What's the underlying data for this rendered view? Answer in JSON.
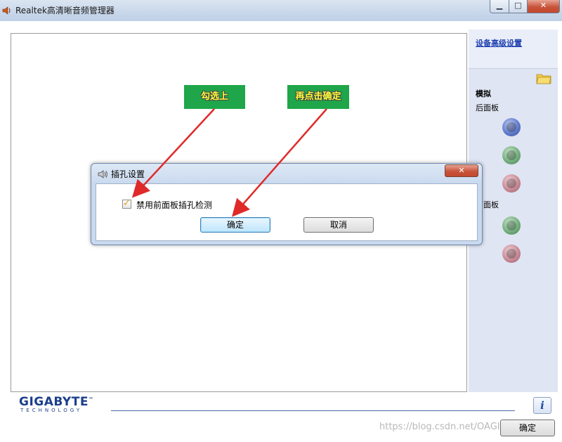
{
  "window": {
    "title": "Realtek高清晰音频管理器",
    "min_glyph": "▁",
    "max_glyph": "□",
    "close_glyph": "✕"
  },
  "side_panel": {
    "advanced_link": "设备高级设置",
    "analog_label": "模拟",
    "back_panel_label": "后面板",
    "front_panel_label": "前面板",
    "back_jacks": [
      {
        "color": "blue"
      },
      {
        "color": "green"
      },
      {
        "color": "pink"
      }
    ],
    "front_jacks": [
      {
        "color": "green"
      },
      {
        "color": "pink"
      }
    ]
  },
  "dialog": {
    "title": "插孔设置",
    "close_glyph": "✕",
    "checkbox_label": "禁用前面板插孔检测",
    "checkbox_checked": true,
    "ok_label": "确定",
    "cancel_label": "取消"
  },
  "annotations": {
    "callout1": "勾选上",
    "callout2": "再点击确定",
    "arrow_color": "#e02a2a"
  },
  "footer": {
    "logo_main": "GIGABYTE",
    "logo_tm": "™",
    "logo_sub": "TECHNOLOGY",
    "info_glyph": "i",
    "ok_label": "确定"
  },
  "watermark": "https://blog.csdn.net/OAGIS..."
}
